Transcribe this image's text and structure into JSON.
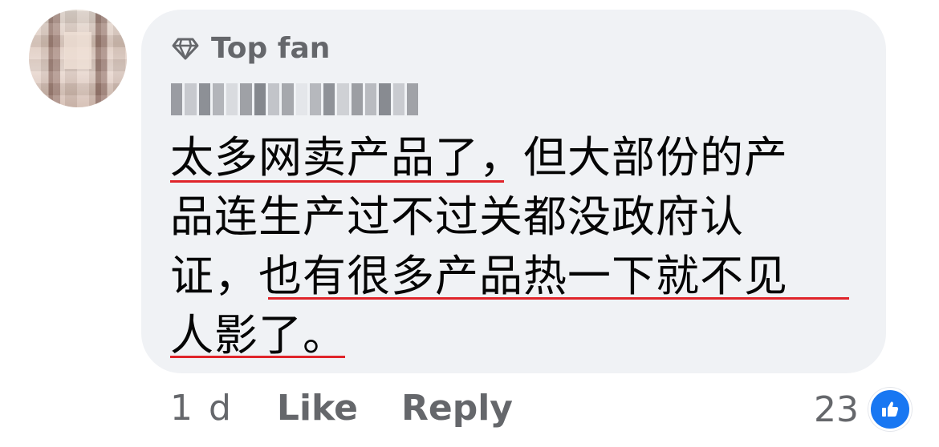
{
  "badge": {
    "label": "Top fan",
    "icon": "diamond-icon"
  },
  "comment": {
    "lines": [
      "太多网卖产品了，但大部份的产",
      "品连生产过不过关都没政府认",
      "证，也有很多产品热一下就不见",
      "人影了。"
    ]
  },
  "actions": {
    "time": "1 d",
    "like": "Like",
    "reply": "Reply"
  },
  "reactions": {
    "count": "23",
    "icon": "like-thumb-icon"
  },
  "colors": {
    "bubble": "#f0f2f5",
    "secondary_text": "#65676b",
    "like_blue": "#1877f2",
    "underline_red": "#e0242a"
  }
}
